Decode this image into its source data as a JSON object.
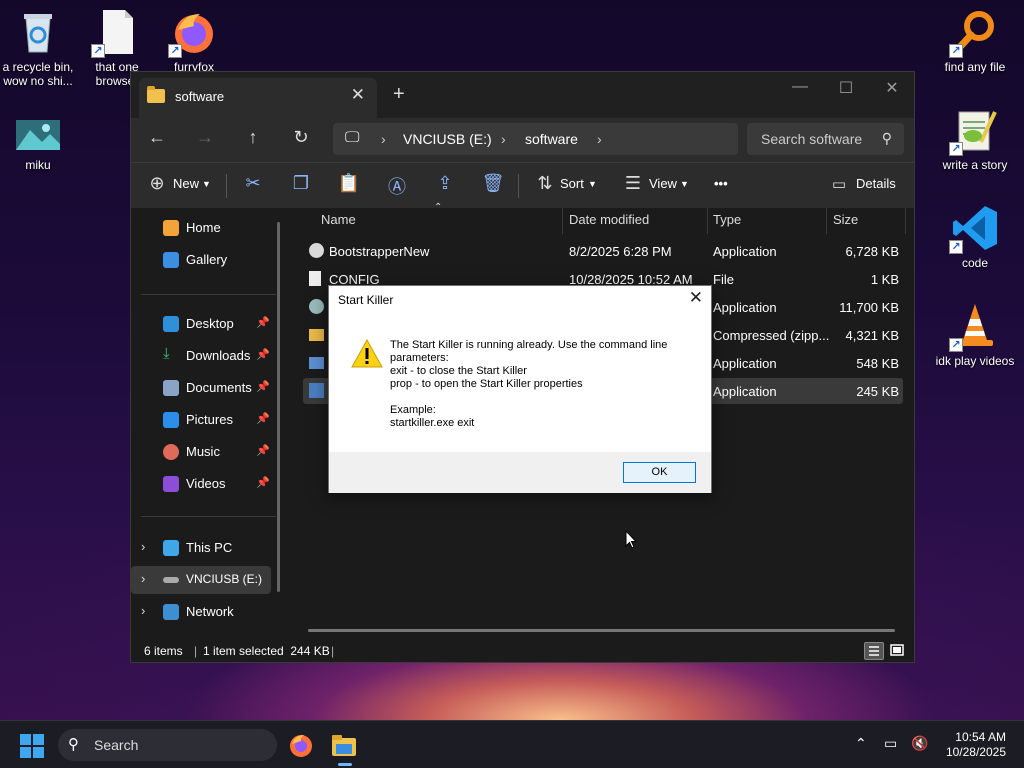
{
  "desktop": {
    "icons": [
      {
        "label": "a recycle bin, wow no shi..."
      },
      {
        "label": "that one browser"
      },
      {
        "label": "furryfox"
      },
      {
        "label": "miku"
      },
      {
        "label": "find any file"
      },
      {
        "label": "write a story"
      },
      {
        "label": "code"
      },
      {
        "label": "idk play videos"
      }
    ]
  },
  "explorer": {
    "tab_title": "software",
    "new_tab": "+",
    "address": {
      "drive": "VNCIUSB (E:)",
      "folder": "software"
    },
    "search_placeholder": "Search software",
    "toolbar": {
      "new_label": "New",
      "sort_label": "Sort",
      "view_label": "View",
      "more_label": "•••",
      "details_label": "Details"
    },
    "nav": {
      "home": "Home",
      "gallery": "Gallery",
      "desktop": "Desktop",
      "downloads": "Downloads",
      "documents": "Documents",
      "pictures": "Pictures",
      "music": "Music",
      "videos": "Videos",
      "this_pc": "This PC",
      "vnciusb": "VNCIUSB (E:)",
      "network": "Network"
    },
    "columns": {
      "name": "Name",
      "date": "Date modified",
      "type": "Type",
      "size": "Size"
    },
    "files": [
      {
        "name": "BootstrapperNew",
        "date": "8/2/2025 6:28 PM",
        "type": "Application",
        "size": "6,728 KB"
      },
      {
        "name": "CONFIG",
        "date": "10/28/2025 10:52 AM",
        "type": "File",
        "size": "1 KB"
      },
      {
        "name": "",
        "date": "",
        "type": "Application",
        "size": "11,700 KB"
      },
      {
        "name": "",
        "date": "",
        "type": "Compressed (zipp...",
        "size": "4,321 KB"
      },
      {
        "name": "",
        "date": "",
        "type": "Application",
        "size": "548 KB"
      },
      {
        "name": "",
        "date": "",
        "type": "Application",
        "size": "245 KB"
      }
    ],
    "status": {
      "items": "6 items",
      "selected": "1 item selected  244 KB"
    }
  },
  "dialog": {
    "title": "Start Killer",
    "message": "The Start Killer is running already. Use the command line\nparameters:\nexit - to close the Start Killer\nprop - to open the Start Killer properties\n\nExample:\nstartkiller.exe exit",
    "ok_label": "OK"
  },
  "taskbar": {
    "search_placeholder": "Search",
    "time": "10:54 AM",
    "date": "10/28/2025"
  },
  "colors": {
    "accent": "#0078d7",
    "folder": "#f0c24b",
    "selected_row": "#3a3a3a"
  }
}
